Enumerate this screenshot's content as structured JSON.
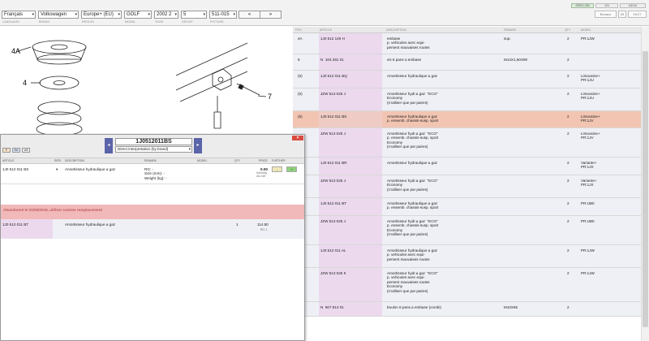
{
  "toolbar": {
    "language": "Français",
    "brand": "Volkswagen",
    "market": "Europe+ (EU)",
    "model": "GOLF",
    "year": "2002",
    "type": "2",
    "group": "5",
    "subgroup": "511-015",
    "prev": "«",
    "next": "»",
    "labels": {
      "language": "LANGUAGE",
      "brand": "BRAND",
      "market": "REGION",
      "model": "MODEL",
      "year": "YEAR",
      "group": "GROUP",
      "subgroup": "PICTURE"
    },
    "buttons": {
      "zero_vin": "ZERO-VIN",
      "vin": "VIN",
      "menu": "MENU"
    },
    "small_boxes": [
      "Bonaco",
      "05",
      "09:27"
    ]
  },
  "drawing": {
    "callouts": [
      "4A",
      "4",
      "7"
    ]
  },
  "parts_table": {
    "headers": {
      "pos": "POS",
      "article": "ARTICLE",
      "description": "DESCRIPTION",
      "remark": "REMARK",
      "qty": "QTY",
      "model": "MODEL"
    },
    "rows": [
      {
        "pos": "4A",
        "article": "1J0 512 149 H",
        "description": "embase\np. vehicules avec equi-\npement mauvaises routes",
        "remark": "sup.",
        "qty": "2",
        "model": "PR:1JW"
      },
      {
        "pos": "5",
        "article": "N  104 281 01",
        "description": "vis 6 pans a embase",
        "remark": "M14X1,50X90",
        "qty": "2",
        "model": ""
      },
      {
        "pos": "(6)",
        "article": "1J0 512 011 BQ",
        "description": "Amortisseur hydraulique a gaz",
        "remark": "",
        "qty": "2",
        "model": "Limousine+\nPR:1JU"
      },
      {
        "pos": "(6)",
        "article": "JZW 513 025 J",
        "description": "Amortisseur hydr.a gaz  \"ECO\"\nEconomy\n(n'utiliser que par paires)",
        "remark": "",
        "qty": "2",
        "model": "Limousine+\nPR:1JU"
      },
      {
        "pos": "(6)",
        "article": "1J0 512 011 BS",
        "description": "Amortisseur hydraulique a gaz\np. ensemb. chassis-susp. sport",
        "remark": "",
        "qty": "2",
        "model": "Limousine+\nPR:1JV"
      },
      {
        "pos": "",
        "article": "JZW 513 025 J",
        "description": "Amortisseur hydr.a gaz  \"ECO\"\np. ensemb. chassis-susp. sport\nEconomy\n(n'utiliser que par paires)",
        "remark": "",
        "qty": "2",
        "model": "Limousine+\nPR:1JV"
      },
      {
        "pos": "",
        "article": "1J0 512 011 BR",
        "description": "Amortisseur hydraulique a gaz",
        "remark": "",
        "qty": "2",
        "model": "Variante+\nPR:1JX"
      },
      {
        "pos": "",
        "article": "JZW 513 025 J",
        "description": "Amortisseur hydr.a gaz  \"ECO\"\nEconomy\n(n'utiliser que par paires)",
        "remark": "",
        "qty": "2",
        "model": "Variante+\nPR:1JX"
      },
      {
        "pos": "",
        "article": "1J0 512 011 BT",
        "description": "Amortisseur hydraulique a gaz\np. ensemb. chassis-susp. sport",
        "remark": "",
        "qty": "2",
        "model": "PR:UB0"
      },
      {
        "pos": "",
        "article": "JZW 513 025 J",
        "description": "Amortisseur hydr.a gaz  \"ECO\"\np. ensemb. chassis-susp. sport\nEconomy\n(n'utiliser que par paires)",
        "remark": "",
        "qty": "2",
        "model": "PR:UB0"
      },
      {
        "pos": "",
        "article": "1J0 512 011 AL",
        "description": "Amortisseur hydraulique a gaz\np. vehicules avec equi-\npement mauvaises routes",
        "remark": "",
        "qty": "2",
        "model": "PR:1JW"
      },
      {
        "pos": "",
        "article": "JZW 513 025 K",
        "description": "Amortisseur hydr.a gaz  \"ECO\"\np. vehicules avec equi-\npement mauvaises routes\nEconomy\n(n'utiliser que par paires)",
        "remark": "",
        "qty": "2",
        "model": "PR:1JW"
      },
      {
        "pos": "8",
        "article": "N  907 813 01",
        "description": "boulon 6 pans a embase (combi)",
        "remark": "M10X65",
        "qty": "2",
        "model": ""
      }
    ]
  },
  "popup": {
    "close": "×",
    "flags": [
      "F",
      "EU",
      "US"
    ],
    "part_number": "1J0512011BS",
    "interpretation": "Direct interpretation (by brand)",
    "headers": {
      "article": "ARTICLE",
      "repl": "REPL",
      "description": "DESCRIPTION",
      "remark": "REMARK",
      "model": "MODEL",
      "qty": "QTY",
      "price": "PRICE",
      "further": "FURTHER"
    },
    "row1": {
      "article": "1J0 512 011 BS",
      "repl": "▾",
      "description": "Amortisseur hydraulique a gaz",
      "remark": "RG: -\nSize (mm): -\nWeight (kg): -",
      "price": "0.00",
      "price_note": "Germany\nvno VAT",
      "minus": "-",
      "plus": "+"
    },
    "warning": "Abandonné le 01/05/2018, utiliser comme remplacement",
    "row2": {
      "article": "1J0 512 011 BT",
      "description": "Amortisseur hydraulique a gaz",
      "qty": "1",
      "price": "114.50",
      "price_note": "RG: 1"
    }
  }
}
